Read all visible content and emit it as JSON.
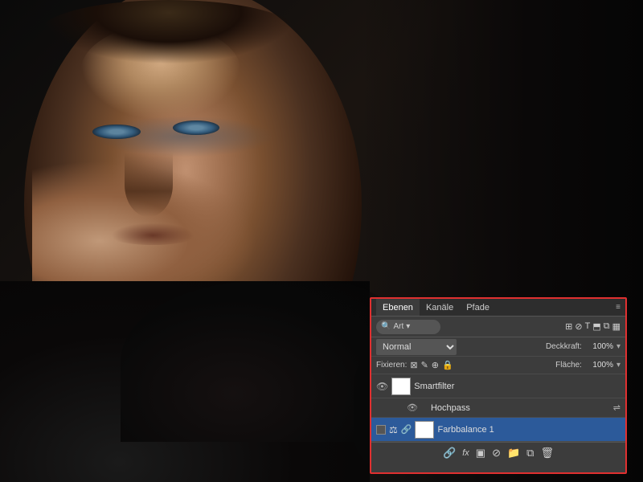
{
  "canvas": {
    "alt": "Portrait photo of man in dark jacket"
  },
  "panel": {
    "tabs": [
      {
        "label": "Ebenen",
        "active": true
      },
      {
        "label": "Kanäle",
        "active": false
      },
      {
        "label": "Pfade",
        "active": false
      }
    ],
    "menu_icon": "≡",
    "toolbar1": {
      "search_icon": "🔍",
      "search_placeholder": "Art",
      "dropdown": "Art",
      "icons": [
        "⊞",
        "⊘",
        "T",
        "⬒",
        "⧉",
        "▦"
      ]
    },
    "toolbar2": {
      "blend_mode": "Normal",
      "opacity_label": "Deckkraft:",
      "opacity_value": "100%",
      "opacity_dropdown": "▾"
    },
    "toolbar3": {
      "fix_label": "Fixieren:",
      "fix_icons": [
        "⊠",
        "✎",
        "⊕",
        "🔒"
      ],
      "fill_label": "Fläche:",
      "fill_value": "100%",
      "fill_dropdown": "▾"
    },
    "layers": [
      {
        "id": "smartfilter",
        "visible": true,
        "thumb": "white",
        "name": "Smartfilter",
        "selected": false,
        "sub": false
      },
      {
        "id": "hochpass",
        "visible": true,
        "thumb": null,
        "name": "Hochpass",
        "selected": false,
        "sub": true
      },
      {
        "id": "farbbalance",
        "visible": true,
        "thumb": "white",
        "name": "Farbbalance 1",
        "selected": true,
        "sub": false
      }
    ],
    "bottom_icons": [
      "🔗",
      "fx",
      "▣",
      "⊘",
      "📁",
      "⧉",
      "🗑"
    ]
  }
}
